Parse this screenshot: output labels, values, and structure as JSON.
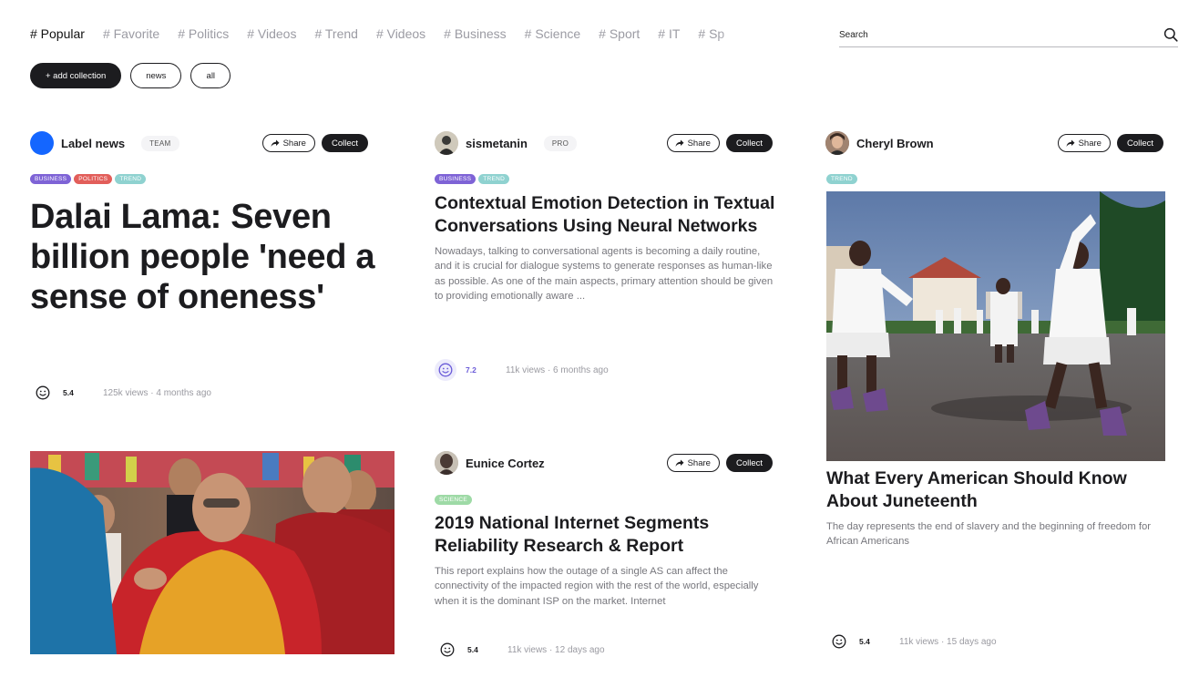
{
  "nav": {
    "tags": [
      "# Popular",
      "# Favorite",
      "# Politics",
      "# Videos",
      "# Trend",
      "# Videos",
      "# Business",
      "# Science",
      "# Sport",
      "# IT",
      "# Sp"
    ],
    "search_placeholder": "Search"
  },
  "pills": {
    "add": "+ add collection",
    "news": "news",
    "all": "all"
  },
  "buttons": {
    "share": "Share",
    "collect": "Collect"
  },
  "colors": {
    "dark": "#1c1c1f",
    "business": "#7e63d6",
    "politics": "#e25e5a",
    "trend": "#8fd2d0",
    "science": "#9edaa6",
    "accent_blue": "#1466ff"
  },
  "cards": [
    {
      "author": "Label news",
      "plan": "TEAM",
      "categories": [
        "BUSINESS",
        "POLITICS",
        "TREND"
      ],
      "title": "Dalai Lama: Seven billion people 'need a sense of oneness'",
      "score": "5.4",
      "meta": "125k views  ·  4 months ago"
    },
    {
      "author": "sismetanin",
      "plan": "PRO",
      "categories": [
        "BUSINESS",
        "TREND"
      ],
      "title": "Contextual Emotion Detection in Textual Conversations Using Neural Networks",
      "excerpt": "Nowadays, talking to conversational agents is becoming a daily routine, and it is crucial for dialogue systems to generate responses as human-like as possible. As one of the main aspects, primary attention should be given to providing emotionally aware ...",
      "score": "7.2",
      "meta": "11k views  ·  6 months ago"
    },
    {
      "author": "Cheryl Brown",
      "categories": [
        "TREND"
      ],
      "title": "What Every American Should Know About Juneteenth",
      "excerpt": "The day represents the end of slavery and the beginning of freedom for African Americans",
      "score": "5.4",
      "meta": "11k views  ·  15 days ago"
    },
    {
      "author": "Eunice Cortez",
      "categories": [
        "SCIENCE"
      ],
      "title": "2019 National Internet Segments Reliability Research & Report",
      "excerpt": "This report explains how the outage of a single AS can affect the connectivity of the impacted region with the rest of the world, especially when it is the dominant ISP on the market. Internet",
      "score": "5.4",
      "meta": "11k views  ·  12 days ago"
    }
  ]
}
